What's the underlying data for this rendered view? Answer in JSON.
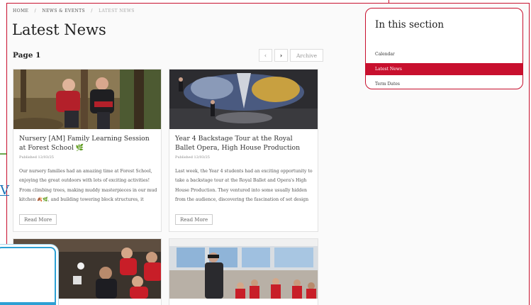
{
  "breadcrumb": {
    "home": "HOME",
    "news_events": "NEWS & EVENTS",
    "current": "LATEST NEWS",
    "separator": "/"
  },
  "page": {
    "title": "Latest News",
    "page_label": "Page 1"
  },
  "pager": {
    "prev_icon": "chevron-left-icon",
    "next_icon": "chevron-right-icon",
    "prev_glyph": "‹",
    "next_glyph": "›",
    "archive_label": "Archive"
  },
  "articles": [
    {
      "title": "Nursery [AM] Family Learning Session at Forest School 🌿",
      "published": "Published 12/03/25",
      "excerpt": "Our nursery families had an amazing time at Forest School, enjoying the great outdoors with lots of exciting activities! From climbing trees, making muddy masterpieces in our mud kitchen 🍂🌿, and building towering block structures, it",
      "read_more": "Read More"
    },
    {
      "title": "Year 4 Backstage Tour at the Royal Ballet Opera, High House Production",
      "published": "Published 12/03/25",
      "excerpt": "Last week, the Year 4 students had an exciting opportunity to take a backstage tour at the Royal Ballet and Opera's High House Production. They ventured into some usually hidden from the audience, discovering the fascination of set design",
      "read_more": "Read More"
    },
    {
      "title": "",
      "published": "",
      "excerpt": "",
      "read_more": ""
    },
    {
      "title": "",
      "published": "",
      "excerpt": "",
      "read_more": ""
    }
  ],
  "sidebar": {
    "heading": "In this section",
    "items": [
      {
        "label": "Calendar",
        "active": false
      },
      {
        "label": "Latest News",
        "active": true
      },
      {
        "label": "Term Dates",
        "active": false
      }
    ]
  },
  "stray": {
    "letter": "V"
  },
  "colors": {
    "accent": "#c8102e",
    "overlay_border": "#2da0d4",
    "link_blue": "#1a73b8"
  }
}
